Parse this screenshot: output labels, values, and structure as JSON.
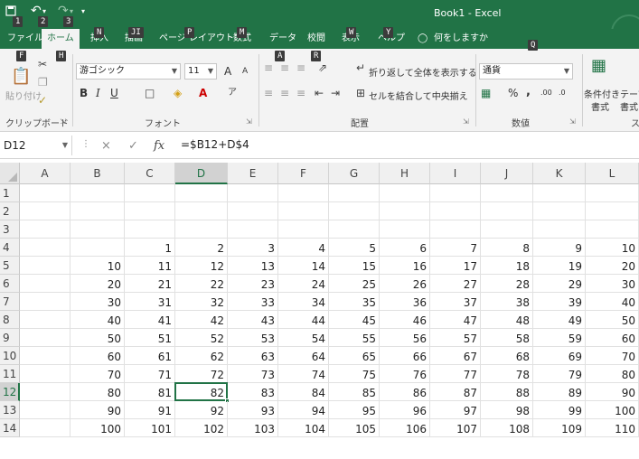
{
  "window": {
    "title": "Book1  -  Excel",
    "qat": {
      "save_icon": "save-icon",
      "undo_icon": "undo-icon",
      "redo_icon": "redo-icon",
      "customize_icon": "customize-qat-icon"
    },
    "qat_keytips": [
      "1",
      "2",
      "3"
    ]
  },
  "ribbon_tabs": [
    "ファイル",
    "ホーム",
    "挿入",
    "描画",
    "ページ レイアウト",
    "数式",
    "データ",
    "校閲",
    "表示",
    "ヘルプ"
  ],
  "tellme": "何をしますか",
  "tab_keytips": [
    "F",
    "H",
    "N",
    "JI",
    "P",
    "M",
    "A",
    "R",
    "W",
    "Y",
    "Q"
  ],
  "ribbon": {
    "clipboard": {
      "paste_label": "貼り付け",
      "group_label": "クリップボード"
    },
    "font": {
      "font_name": "游ゴシック",
      "font_size": "11",
      "bold": "B",
      "italic": "I",
      "underline": "U",
      "grow": "A",
      "shrink": "A",
      "group_label": "フォント"
    },
    "alignment": {
      "wrap_text": "折り返して全体を表示する",
      "merge_center": "セルを結合して中央揃え",
      "group_label": "配置"
    },
    "number": {
      "format": "通貨",
      "percent": "%",
      "comma": ",",
      "inc_decimal": ".00",
      "dec_decimal": ".0",
      "group_label": "数値"
    },
    "styles": {
      "conditional": "条件付き",
      "conditional_sub": "書式",
      "table": "テーブ",
      "table_sub": "書式",
      "group_label": "ス"
    }
  },
  "formula_bar": {
    "name_box": "D12",
    "cancel": "×",
    "enter": "✓",
    "fx": "fx",
    "formula": "=$B12+D$4"
  },
  "grid": {
    "columns": [
      "A",
      "B",
      "C",
      "D",
      "E",
      "F",
      "G",
      "H",
      "I",
      "J",
      "K",
      "L"
    ],
    "selected_column": "D",
    "selected_row": "12",
    "rows": [
      {
        "num": "1",
        "cells": [
          "",
          "",
          "",
          "",
          "",
          "",
          "",
          "",
          "",
          "",
          "",
          ""
        ]
      },
      {
        "num": "2",
        "cells": [
          "",
          "",
          "",
          "",
          "",
          "",
          "",
          "",
          "",
          "",
          "",
          ""
        ]
      },
      {
        "num": "3",
        "cells": [
          "",
          "",
          "",
          "",
          "",
          "",
          "",
          "",
          "",
          "",
          "",
          ""
        ]
      },
      {
        "num": "4",
        "cells": [
          "",
          "",
          "1",
          "2",
          "3",
          "4",
          "5",
          "6",
          "7",
          "8",
          "9",
          "10"
        ]
      },
      {
        "num": "5",
        "cells": [
          "",
          "10",
          "11",
          "12",
          "13",
          "14",
          "15",
          "16",
          "17",
          "18",
          "19",
          "20"
        ]
      },
      {
        "num": "6",
        "cells": [
          "",
          "20",
          "21",
          "22",
          "23",
          "24",
          "25",
          "26",
          "27",
          "28",
          "29",
          "30"
        ]
      },
      {
        "num": "7",
        "cells": [
          "",
          "30",
          "31",
          "32",
          "33",
          "34",
          "35",
          "36",
          "37",
          "38",
          "39",
          "40"
        ]
      },
      {
        "num": "8",
        "cells": [
          "",
          "40",
          "41",
          "42",
          "43",
          "44",
          "45",
          "46",
          "47",
          "48",
          "49",
          "50"
        ]
      },
      {
        "num": "9",
        "cells": [
          "",
          "50",
          "51",
          "52",
          "53",
          "54",
          "55",
          "56",
          "57",
          "58",
          "59",
          "60"
        ]
      },
      {
        "num": "10",
        "cells": [
          "",
          "60",
          "61",
          "62",
          "63",
          "64",
          "65",
          "66",
          "67",
          "68",
          "69",
          "70"
        ]
      },
      {
        "num": "11",
        "cells": [
          "",
          "70",
          "71",
          "72",
          "73",
          "74",
          "75",
          "76",
          "77",
          "78",
          "79",
          "80"
        ]
      },
      {
        "num": "12",
        "cells": [
          "",
          "80",
          "81",
          "82",
          "83",
          "84",
          "85",
          "86",
          "87",
          "88",
          "89",
          "90"
        ]
      },
      {
        "num": "13",
        "cells": [
          "",
          "90",
          "91",
          "92",
          "93",
          "94",
          "95",
          "96",
          "97",
          "98",
          "99",
          "100"
        ]
      },
      {
        "num": "14",
        "cells": [
          "",
          "100",
          "101",
          "102",
          "103",
          "104",
          "105",
          "106",
          "107",
          "108",
          "109",
          "110"
        ]
      }
    ]
  },
  "colors": {
    "accent": "#217346",
    "ribbon_bg": "#f3f3f3",
    "header_bg": "#f0f0f0",
    "selected_header_bg": "#d2d2d2"
  }
}
